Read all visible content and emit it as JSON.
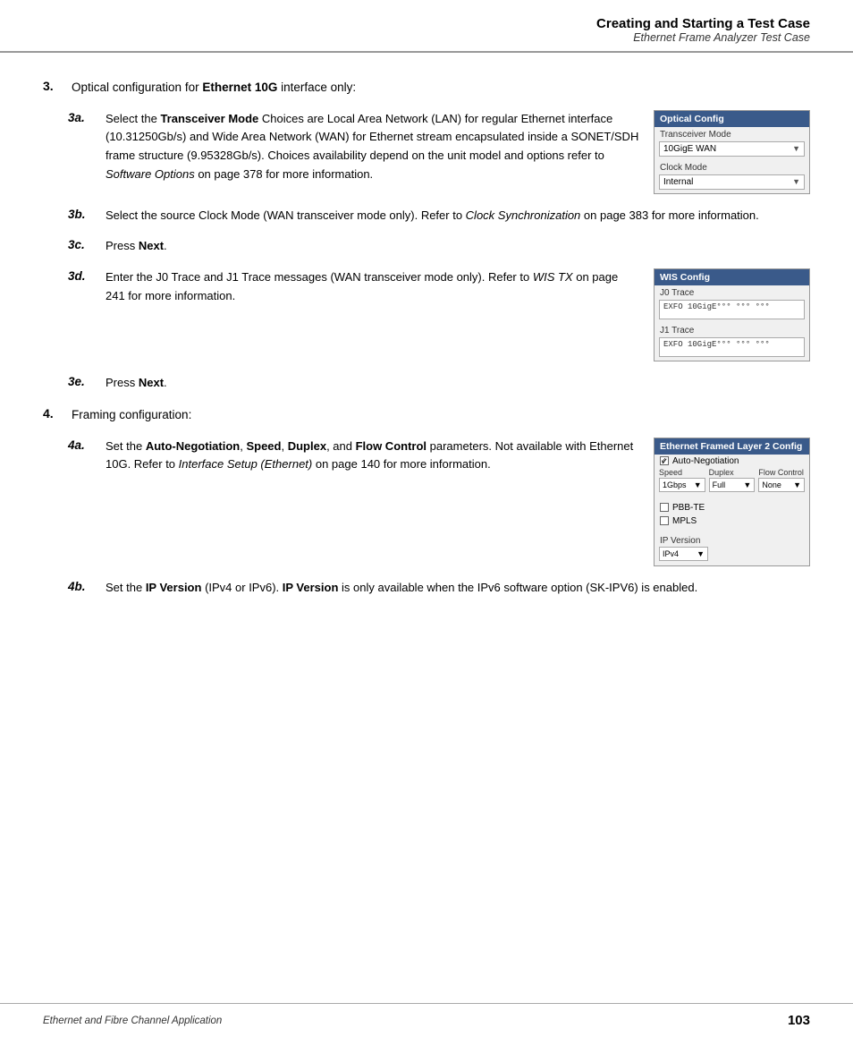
{
  "header": {
    "title": "Creating and Starting a Test Case",
    "subtitle": "Ethernet Frame Analyzer Test Case"
  },
  "content": {
    "step3": {
      "num": "3.",
      "text_before": "Optical configuration for ",
      "text_bold": "Ethernet 10G",
      "text_after": " interface only:",
      "substeps": [
        {
          "num": "3a.",
          "text": "Select the <b>Transceiver Mode</b> Choices are Local Area Network (LAN) for regular Ethernet interface (10.31250Gb/s) and Wide Area Network (WAN) for Ethernet stream encapsulated inside a SONET/SDH frame structure (9.95328Gb/s). Choices availability depend on the unit model and options refer to <i>Software Options</i> on page 378 for more information.",
          "config": {
            "title": "Optical Config",
            "fields": [
              {
                "label": "Transceiver Mode",
                "value": "10GigE WAN",
                "hasDropdown": true
              },
              {
                "label": "Clock Mode",
                "value": "Internal",
                "hasDropdown": true
              }
            ]
          }
        },
        {
          "num": "3b.",
          "text": "Select the source Clock Mode (WAN transceiver mode only). Refer to <i>Clock Synchronization</i> on page 383 for more information.",
          "config": null
        },
        {
          "num": "3c.",
          "text": "Press <b>Next</b>.",
          "config": null
        },
        {
          "num": "3d.",
          "text": "Enter the J0 Trace and J1 Trace messages (WAN transceiver mode only). Refer to <i>WIS TX</i> on page 241 for more information.",
          "config": {
            "title": "WIS Config",
            "fields": [
              {
                "label": "J0 Trace",
                "trace": "EXFO 10GigE°°° °°° °°° °°°"
              },
              {
                "label": "J1 Trace",
                "trace": "EXFO 10GigE°°° °°° °°° °°°"
              }
            ]
          }
        },
        {
          "num": "3e.",
          "text": "Press <b>Next</b>.",
          "config": null
        }
      ]
    },
    "step4": {
      "num": "4.",
      "text": "Framing configuration:",
      "substeps": [
        {
          "num": "4a.",
          "text": "Set the <b>Auto-Negotiation</b>, <b>Speed</b>, <b>Duplex</b>, and <b>Flow Control</b> parameters. Not available with Ethernet 10G. Refer to <i>Interface Setup (Ethernet)</i> on page 140 for more information.",
          "config": {
            "title": "Ethernet Framed Layer 2 Config",
            "autoNegChecked": true,
            "autoNegLabel": "Auto-Negotiation",
            "speedLabel": "Speed",
            "speedValue": "1Gbps",
            "duplexLabel": "Duplex",
            "duplexValue": "Full",
            "flowLabel": "Flow Control",
            "flowValue": "None",
            "checkboxes": [
              {
                "label": "PBB-TE",
                "checked": false
              },
              {
                "label": "MPLS",
                "checked": false
              }
            ],
            "ipVersionLabel": "IP Version",
            "ipVersionValue": "IPv4"
          }
        },
        {
          "num": "4b.",
          "text": "Set the <b>IP Version</b> (IPv4 or IPv6). <b>IP Version</b> is only available when the IPv6 software option (SK-IPV6) is enabled.",
          "config": null
        }
      ]
    }
  },
  "footer": {
    "left": "Ethernet and Fibre Channel Application",
    "right": "103"
  }
}
